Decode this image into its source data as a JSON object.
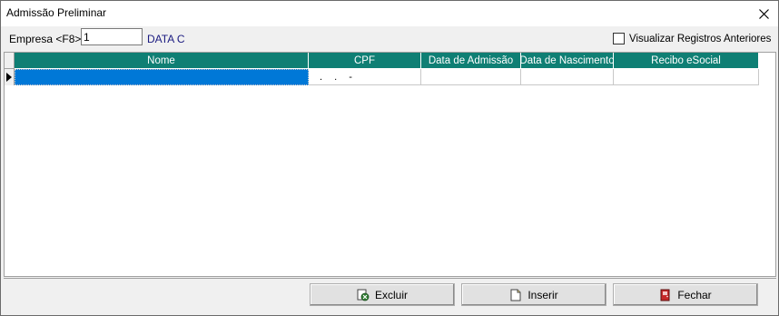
{
  "window": {
    "title": "Admissão Preliminar"
  },
  "toolbar": {
    "empresa_label": "Empresa <F8>",
    "empresa_value": "1",
    "empresa_name": "DATA C",
    "checkbox_label": "Visualizar Registros Anteriores",
    "checkbox_checked": false
  },
  "grid": {
    "columns": [
      "Nome",
      "CPF",
      "Data de Admissão",
      "Data de Nascimento",
      "Recibo eSocial"
    ],
    "rows": [
      {
        "nome": "",
        "cpf": ". . -",
        "data_admissao": "",
        "data_nascimento": "",
        "recibo": ""
      }
    ],
    "header_color": "#0f7f74",
    "selection_color": "#0078d7"
  },
  "buttons": {
    "excluir": "Excluir",
    "inserir": "Inserir",
    "fechar": "Fechar"
  }
}
